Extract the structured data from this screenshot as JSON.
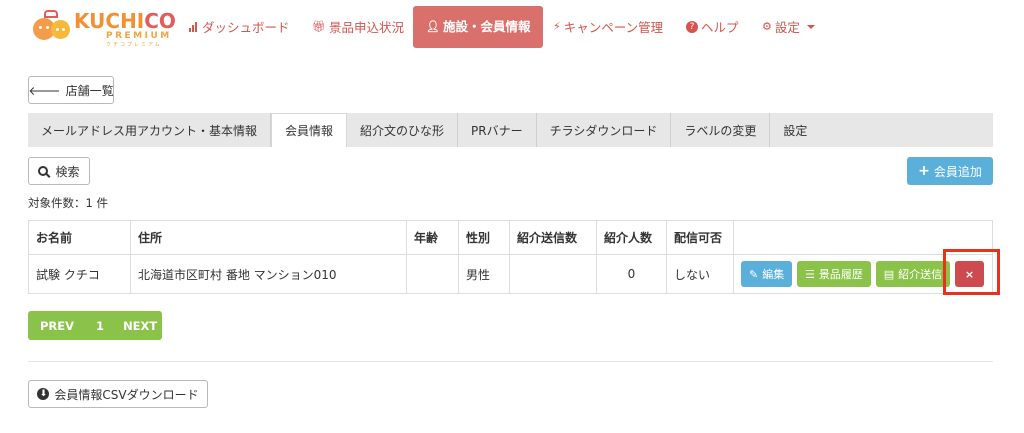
{
  "brand": {
    "name_main": "KUCHI",
    "name_accent": "CO",
    "sub": "PREMIUM",
    "kana": "クチコプレミアム"
  },
  "nav": {
    "items": [
      {
        "label": "ダッシュボード",
        "icon": "bar-chart-icon"
      },
      {
        "label": "景品申込状況",
        "icon": "gift-icon"
      },
      {
        "label": "施設・会員情報",
        "icon": "user-icon",
        "active": true
      },
      {
        "label": "キャンペーン管理",
        "icon": "bolt-icon"
      },
      {
        "label": "ヘルプ",
        "icon": "question-circle-icon"
      },
      {
        "label": "設定",
        "icon": "gear-icon"
      }
    ]
  },
  "back_button": {
    "label": "店舗一覧",
    "icon": "arrow-left-icon"
  },
  "tabs": [
    {
      "label": "メールアドレス用アカウント・基本情報"
    },
    {
      "label": "会員情報",
      "active": true
    },
    {
      "label": "紹介文のひな形"
    },
    {
      "label": "PRバナー"
    },
    {
      "label": "チラシダウンロード"
    },
    {
      "label": "ラベルの変更"
    },
    {
      "label": "設定"
    }
  ],
  "search_button": {
    "label": "検索",
    "icon": "search-icon"
  },
  "add_member_button": {
    "label": "会員追加",
    "icon": "plus-icon"
  },
  "result_count": "対象件数：1 件",
  "table": {
    "headers": [
      "お名前",
      "住所",
      "年齢",
      "性別",
      "紹介送信数",
      "紹介人数",
      "配信可否",
      ""
    ],
    "rows": [
      {
        "name": "試験 クチコ",
        "address": "北海道市区町村 番地 マンション010",
        "age": "",
        "gender": "男性",
        "sent": "",
        "referrals": "0",
        "delivery": "しない",
        "actions": {
          "edit": "編集",
          "prize_history": "景品履歴",
          "referral_send": "紹介送信",
          "delete_icon": "×"
        }
      }
    ]
  },
  "pagination": {
    "prev": "PREV",
    "current": "1",
    "next": "NEXT"
  },
  "csv_button": {
    "label": "会員情報CSVダウンロード",
    "icon": "download-circle-icon"
  },
  "colors": {
    "nav_red": "#d9534f",
    "nav_active_bg": "#d9706b",
    "primary_blue": "#5bb0db",
    "success_green": "#8bc34a",
    "danger_red": "#cd4b4e",
    "highlight_red": "#e8321c"
  }
}
